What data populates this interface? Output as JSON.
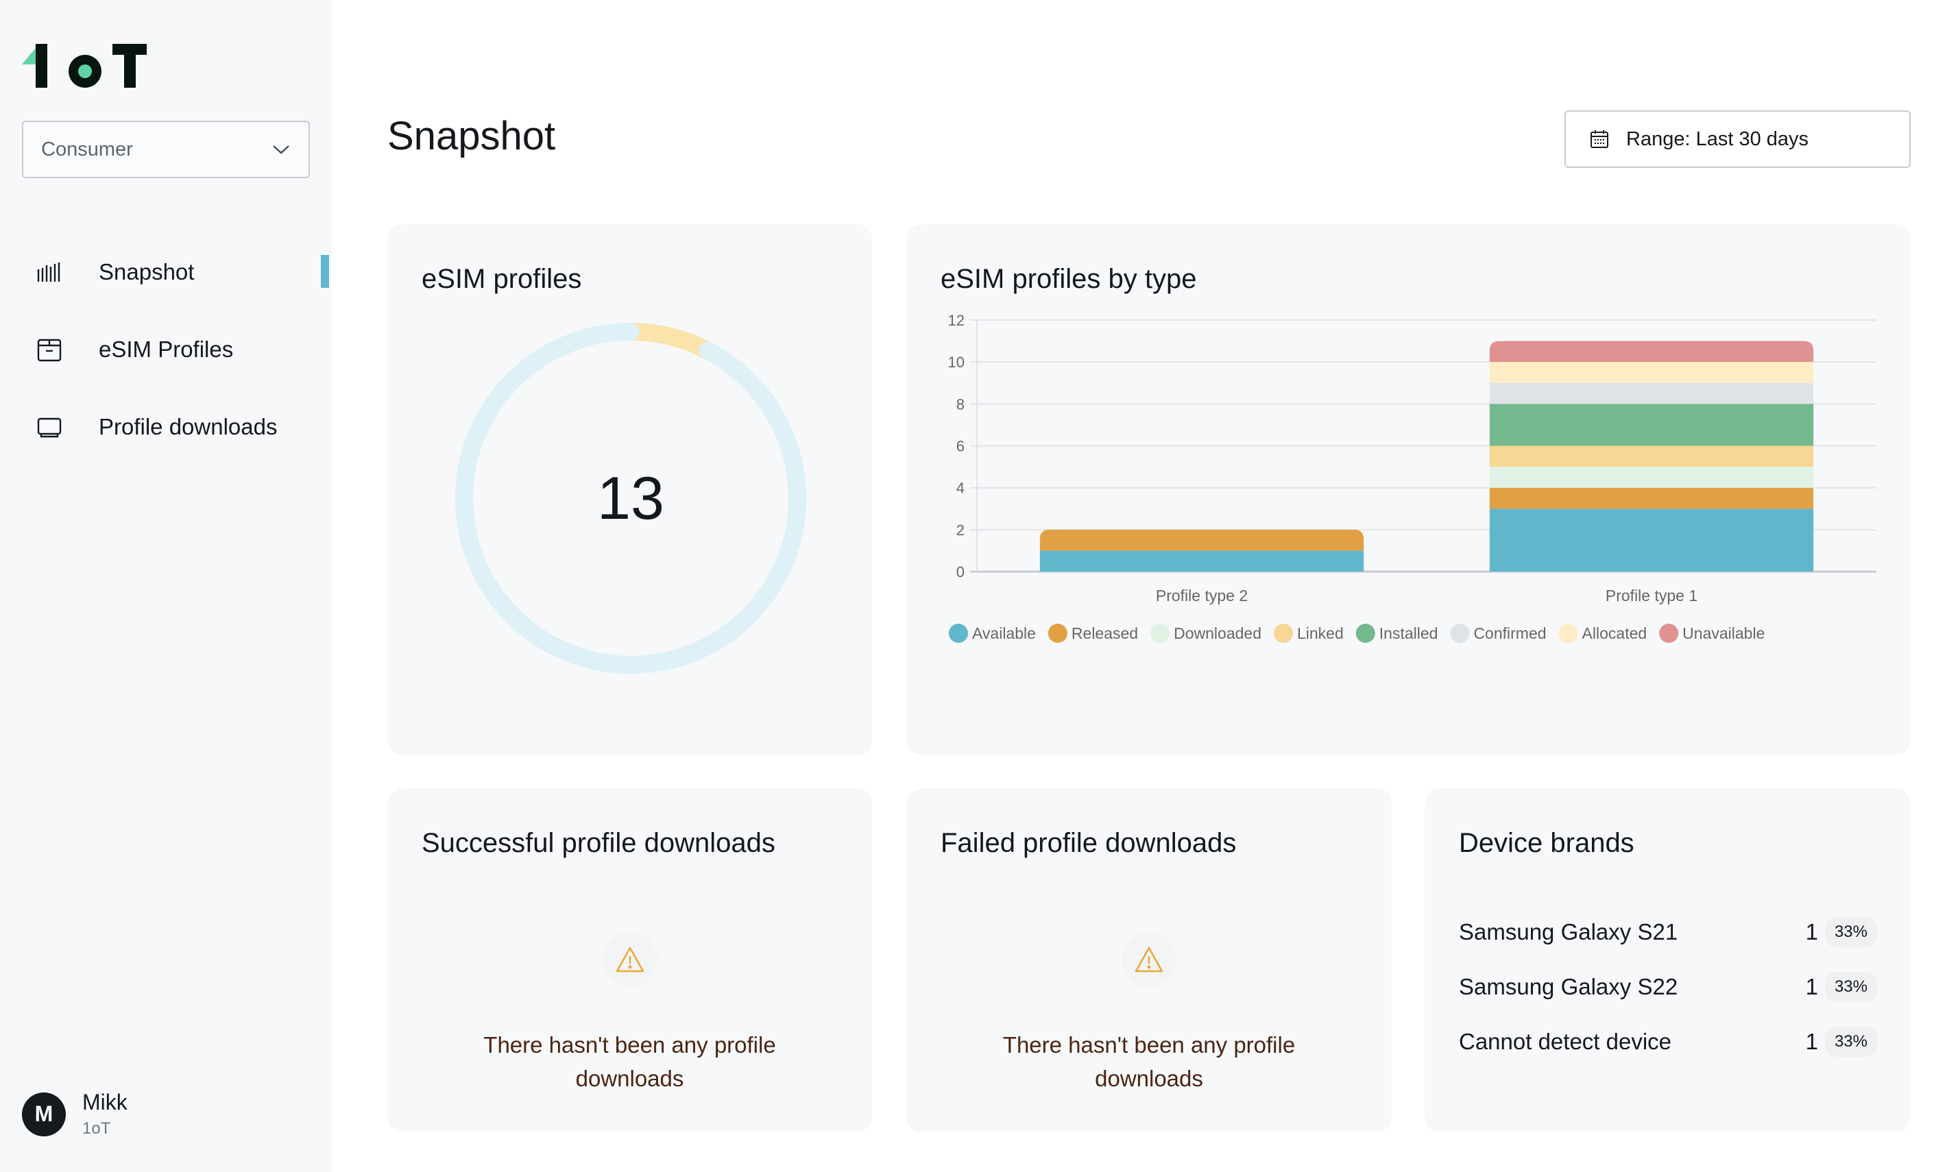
{
  "app": {
    "brand": "1oT"
  },
  "sidebar": {
    "selector": {
      "value": "Consumer"
    },
    "items": [
      {
        "label": "Snapshot",
        "icon": "bar-chart-icon",
        "active": true
      },
      {
        "label": "eSIM Profiles",
        "icon": "box-icon",
        "active": false
      },
      {
        "label": "Profile downloads",
        "icon": "device-icon",
        "active": false
      }
    ],
    "user": {
      "initial": "M",
      "name": "Mikk",
      "org": "1oT"
    }
  },
  "header": {
    "title": "Snapshot",
    "range_label": "Range: Last 30 days"
  },
  "colors": {
    "accent": "#62b6cb",
    "Available": "#62b6cb",
    "Released": "#e2a045",
    "Downloaded": "#e1f2e4",
    "Linked": "#f8d693",
    "Installed": "#74b88e",
    "Confirmed": "#dfe3e6",
    "Allocated": "#feedc4",
    "Unavailable": "#e09292"
  },
  "cards": {
    "total": {
      "title": "eSIM profiles",
      "value": "13",
      "segments": [
        {
          "name": "highlight",
          "value": 1,
          "color": "#fbe4ac"
        },
        {
          "name": "rest",
          "value": 12,
          "color": "#ddf1f6"
        }
      ]
    },
    "by_type": {
      "title": "eSIM profiles by type"
    },
    "success": {
      "title": "Successful profile downloads",
      "empty_message": "There hasn't been any profile downloads"
    },
    "failed": {
      "title": "Failed profile downloads",
      "empty_message": "There hasn't been any profile downloads"
    },
    "brands": {
      "title": "Device brands",
      "rows": [
        {
          "name": "Samsung Galaxy S21",
          "count": "1",
          "percent": "33%"
        },
        {
          "name": "Samsung Galaxy S22",
          "count": "1",
          "percent": "33%"
        },
        {
          "name": "Cannot detect device",
          "count": "1",
          "percent": "33%"
        }
      ]
    }
  },
  "chart_data": {
    "type": "bar",
    "stacked": true,
    "title": "eSIM profiles by type",
    "categories": [
      "Profile type 2",
      "Profile type 1"
    ],
    "series": [
      {
        "name": "Available",
        "values": [
          1,
          3
        ]
      },
      {
        "name": "Released",
        "values": [
          1,
          1
        ]
      },
      {
        "name": "Downloaded",
        "values": [
          0,
          1
        ]
      },
      {
        "name": "Linked",
        "values": [
          0,
          1
        ]
      },
      {
        "name": "Installed",
        "values": [
          0,
          2
        ]
      },
      {
        "name": "Confirmed",
        "values": [
          0,
          1
        ]
      },
      {
        "name": "Allocated",
        "values": [
          0,
          1
        ]
      },
      {
        "name": "Unavailable",
        "values": [
          0,
          1
        ]
      }
    ],
    "ylim": [
      0,
      12
    ],
    "yticks": [
      0,
      2,
      4,
      6,
      8,
      10,
      12
    ],
    "xlabel": "",
    "ylabel": "",
    "grid": true,
    "legend": "bottom"
  }
}
